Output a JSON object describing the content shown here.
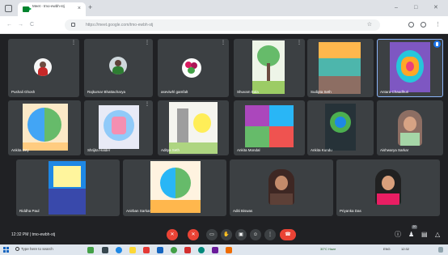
{
  "browser": {
    "tab_title": "Meet - tmo-ewbh-stj",
    "url": "https://meet.google.com/tmo-ewbh-stj",
    "new_tab": "+",
    "close_tab": "×",
    "minimize": "–",
    "maximize": "□",
    "close_window": "✕",
    "back": "←",
    "forward": "→",
    "reload": "C"
  },
  "participants": [
    {
      "name": "Pushali Ghosh",
      "kind": "avatar"
    },
    {
      "name": "Rajkumar Bhattacharya",
      "kind": "avatar"
    },
    {
      "name": "aseviwhl gamfalt",
      "kind": "avatar"
    },
    {
      "name": "Shuvam Bala",
      "kind": "art"
    },
    {
      "name": "Sudipta Seth",
      "kind": "art"
    },
    {
      "name": "Antara Chaudhuri",
      "kind": "art",
      "active": true
    },
    {
      "name": "Ankita Dey",
      "kind": "art"
    },
    {
      "name": "Shrijita Halder",
      "kind": "art"
    },
    {
      "name": "Aditya Seth",
      "kind": "art"
    },
    {
      "name": "Ankita Mondal",
      "kind": "art"
    },
    {
      "name": "Ankita Kundu",
      "kind": "art"
    },
    {
      "name": "Aishwarya Sarkar",
      "kind": "camera"
    },
    {
      "name": "Riddha Paul",
      "kind": "art"
    },
    {
      "name": "Anirban Sarkar",
      "kind": "art"
    },
    {
      "name": "Aditi Biswas",
      "kind": "camera"
    },
    {
      "name": "Priyanka Das",
      "kind": "camera"
    }
  ],
  "meet_bar": {
    "time": "12:32 PM",
    "separator": "|",
    "meeting_code": "tmo-ewbh-stj",
    "badge_count": "20"
  },
  "taskbar": {
    "search_placeholder": "Type here to search",
    "temperature": "30°C",
    "weather": "Haze",
    "language": "ENG",
    "time": "12:32"
  },
  "colors": {
    "meet_bg": "#202124",
    "tile_bg": "#3c4043",
    "end_call": "#ea4335",
    "active_outline": "#8ab4f8"
  }
}
